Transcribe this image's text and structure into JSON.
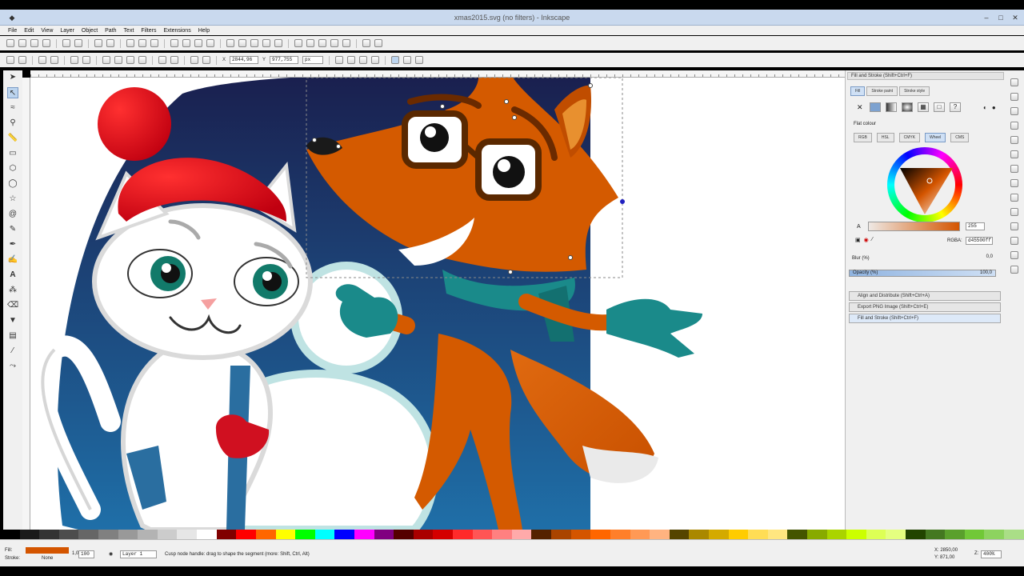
{
  "window": {
    "title": "xmas2015.svg (no filters) - Inkscape"
  },
  "menu": [
    "File",
    "Edit",
    "View",
    "Layer",
    "Object",
    "Path",
    "Text",
    "Filters",
    "Extensions",
    "Help"
  ],
  "toolcontrols": {
    "x_label": "X",
    "x_value": "2844,96",
    "y_label": "Y",
    "y_value": "977,755",
    "unit": "px"
  },
  "dock": {
    "header": "Fill and Stroke (Shift+Ctrl+F)",
    "tabs": [
      "Fill",
      "Stroke paint",
      "Stroke style"
    ],
    "flat_colour_label": "Flat colour",
    "color_modes": [
      "RGB",
      "HSL",
      "CMYK",
      "Wheel",
      "CMS"
    ],
    "active_mode": "Wheel",
    "alpha_value": "255",
    "rgba_label": "RGBA:",
    "rgba_value": "d45500ff",
    "blur_label": "Blur (%)",
    "blur_value": "0,0",
    "opacity_label": "Opacity (%)",
    "opacity_value": "100,0",
    "collapsed_panels": [
      "Align and Distribute (Shift+Ctrl+A)",
      "Export PNG Image (Shift+Ctrl+E)",
      "Fill and Stroke (Shift+Ctrl+F)"
    ]
  },
  "status": {
    "fill_label": "Fill:",
    "stroke_label": "Stroke:",
    "stroke_value": "None",
    "stroke_width": "1,00",
    "opacity_value": "100",
    "layer": "Layer 1",
    "message": "Cusp node handle: drag to shape the segment (more: Shift, Ctrl, Alt)",
    "coord_x": "X: 2850,00",
    "coord_y": "Y: 871,00",
    "zoom_label": "Z:",
    "zoom_value": "400%"
  },
  "colors": {
    "fill_swatch": "#d45500",
    "fox_orange": "#d45a00",
    "night_blue": "#1e4a7a",
    "hat_red": "#e8181c",
    "scarf_teal": "#1a8a8a"
  }
}
